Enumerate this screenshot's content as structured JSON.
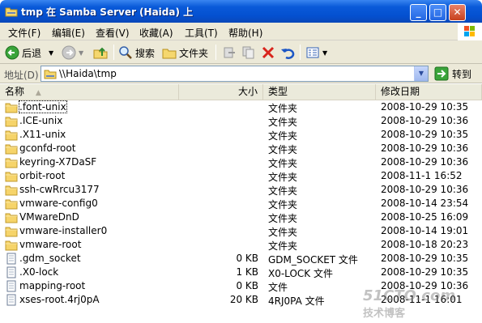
{
  "window": {
    "title": "tmp 在 Samba Server (Haida) 上",
    "buttons": {
      "minimize": "_",
      "maximize": "□",
      "close": "✕"
    }
  },
  "menu": [
    "文件(F)",
    "编辑(E)",
    "查看(V)",
    "收藏(A)",
    "工具(T)",
    "帮助(H)"
  ],
  "toolbar": {
    "back_label": "后退",
    "search_label": "搜索",
    "folders_label": "文件夹"
  },
  "address": {
    "label": "地址(D)",
    "path": "\\\\Haida\\tmp",
    "go_label": "转到"
  },
  "columns": {
    "name": "名称",
    "size": "大小",
    "type": "类型",
    "modified": "修改日期"
  },
  "files": [
    {
      "name": ".font-unix",
      "size": "",
      "type": "文件夹",
      "modified": "2008-10-29 10:35",
      "icon": "folder"
    },
    {
      "name": ".ICE-unix",
      "size": "",
      "type": "文件夹",
      "modified": "2008-10-29 10:36",
      "icon": "folder"
    },
    {
      "name": ".X11-unix",
      "size": "",
      "type": "文件夹",
      "modified": "2008-10-29 10:35",
      "icon": "folder"
    },
    {
      "name": "gconfd-root",
      "size": "",
      "type": "文件夹",
      "modified": "2008-10-29 10:36",
      "icon": "folder"
    },
    {
      "name": "keyring-X7DaSF",
      "size": "",
      "type": "文件夹",
      "modified": "2008-10-29 10:36",
      "icon": "folder"
    },
    {
      "name": "orbit-root",
      "size": "",
      "type": "文件夹",
      "modified": "2008-11-1 16:52",
      "icon": "folder"
    },
    {
      "name": "ssh-cwRrcu3177",
      "size": "",
      "type": "文件夹",
      "modified": "2008-10-29 10:36",
      "icon": "folder"
    },
    {
      "name": "vmware-config0",
      "size": "",
      "type": "文件夹",
      "modified": "2008-10-14 23:54",
      "icon": "folder"
    },
    {
      "name": "VMwareDnD",
      "size": "",
      "type": "文件夹",
      "modified": "2008-10-25 16:09",
      "icon": "folder"
    },
    {
      "name": "vmware-installer0",
      "size": "",
      "type": "文件夹",
      "modified": "2008-10-14 19:01",
      "icon": "folder"
    },
    {
      "name": "vmware-root",
      "size": "",
      "type": "文件夹",
      "modified": "2008-10-18 20:23",
      "icon": "folder"
    },
    {
      "name": ".gdm_socket",
      "size": "0 KB",
      "type": "GDM_SOCKET 文件",
      "modified": "2008-10-29 10:35",
      "icon": "file"
    },
    {
      "name": ".X0-lock",
      "size": "1 KB",
      "type": "X0-LOCK 文件",
      "modified": "2008-10-29 10:35",
      "icon": "file"
    },
    {
      "name": "mapping-root",
      "size": "0 KB",
      "type": "文件",
      "modified": "2008-10-29 10:36",
      "icon": "file"
    },
    {
      "name": "xses-root.4rj0pA",
      "size": "20 KB",
      "type": "4RJ0PA 文件",
      "modified": "2008-11-1 16:01",
      "icon": "file"
    }
  ],
  "watermark": {
    "line1": "51CTO.com",
    "line2": "技术博客"
  }
}
